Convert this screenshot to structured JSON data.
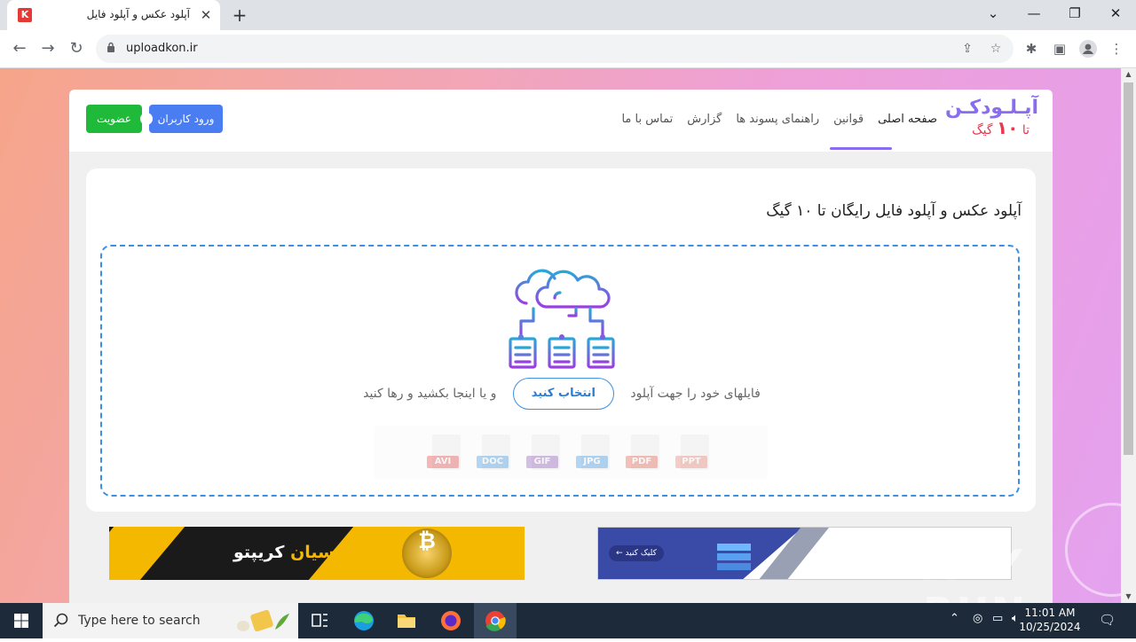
{
  "browser": {
    "tab_title": "آپلود عکس و آپلود فایل",
    "tab_favicon": "K",
    "url": "uploadkon.ir",
    "controls": {
      "minimize": "—",
      "restore": "❐",
      "close": "✕",
      "dropdown": "⌄"
    }
  },
  "site": {
    "logo_line1": "آپـلـودکـن",
    "logo_prefix": "تا",
    "logo_number": "۱۰",
    "logo_suffix": "گیگ",
    "nav": [
      "صفحه اصلی",
      "قوانین",
      "راهنمای پسوند ها",
      "گزارش",
      "تماس با ما"
    ],
    "login_label": "ورود کاربران",
    "signup_label": "عضویت"
  },
  "upload": {
    "heading": "آپلود عکس و آپلود فایل رایگان تا ۱۰ گیگ",
    "text_before": "فایلهای خود را جهت آپلود",
    "choose_label": "انتخاب کنید",
    "text_after": "و یا اینجا بکشید و رها کنید",
    "file_types": [
      {
        "label": "PPT",
        "color": "#e57368"
      },
      {
        "label": "PDF",
        "color": "#e5533e"
      },
      {
        "label": "JPG",
        "color": "#2f8fe0"
      },
      {
        "label": "GIF",
        "color": "#8a4fb8"
      },
      {
        "label": "DOC",
        "color": "#2f8fe0"
      },
      {
        "label": "AVI",
        "color": "#e53a3a"
      }
    ]
  },
  "banners": {
    "crypto_text_1": "پارسیان",
    "crypto_text_2": "کریپتو",
    "host_button": "کلیک کنید"
  },
  "watermark": "ANY RUN",
  "taskbar": {
    "search_placeholder": "Type here to search",
    "time": "11:01 AM",
    "date": "10/25/2024"
  }
}
